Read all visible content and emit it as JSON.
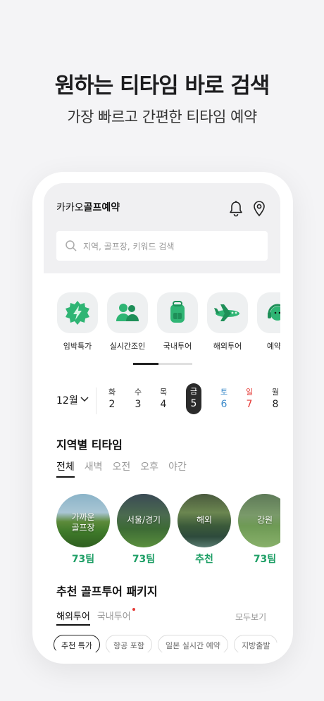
{
  "promo": {
    "title": "원하는 티타임 바로 검색",
    "subtitle": "가장 빠르고 간편한 티타임 예약"
  },
  "header": {
    "app_name_prefix": "카카오",
    "app_name_bold": "골프예약",
    "icons": [
      "bell-icon",
      "location-pin-icon"
    ]
  },
  "search": {
    "placeholder": "지역, 골프장, 키워드 검색"
  },
  "categories": [
    {
      "label": "임박특가",
      "icon": "flash-sale-badge-icon"
    },
    {
      "label": "실시간조인",
      "icon": "people-icon"
    },
    {
      "label": "국내투어",
      "icon": "backpack-icon"
    },
    {
      "label": "해외투어",
      "icon": "airplane-icon"
    },
    {
      "label": "예약매",
      "icon": "headset-icon"
    }
  ],
  "dates": {
    "month": "12월",
    "days": [
      {
        "weekday": "화",
        "num": "2"
      },
      {
        "weekday": "수",
        "num": "3"
      },
      {
        "weekday": "목",
        "num": "4"
      },
      {
        "weekday": "금",
        "num": "5",
        "selected": true
      },
      {
        "weekday": "토",
        "num": "6"
      },
      {
        "weekday": "일",
        "num": "7"
      },
      {
        "weekday": "월",
        "num": "8"
      }
    ]
  },
  "regional": {
    "title": "지역별 티타임",
    "tabs": [
      "전체",
      "새벽",
      "오전",
      "오후",
      "야간"
    ],
    "active_tab": "전체",
    "regions": [
      {
        "name_line1": "가까운",
        "name_line2": "골프장",
        "count": "73팀"
      },
      {
        "name_line1": "서울/경기",
        "name_line2": "",
        "count": "73팀"
      },
      {
        "name_line1": "해외",
        "name_line2": "",
        "count": "추천"
      },
      {
        "name_line1": "강원",
        "name_line2": "",
        "count": "73팀"
      }
    ]
  },
  "packages": {
    "title": "추천 골프투어 패키지",
    "tabs": [
      "해외투어",
      "국내투어"
    ],
    "see_all": "모두보기",
    "chips": [
      "추천 특가",
      "항공 포함",
      "일본 실시간 예약",
      "지방출발"
    ]
  },
  "colors": {
    "accent_green": "#1e9f66",
    "saturday_blue": "#3a89c9",
    "sunday_red": "#e53935"
  }
}
